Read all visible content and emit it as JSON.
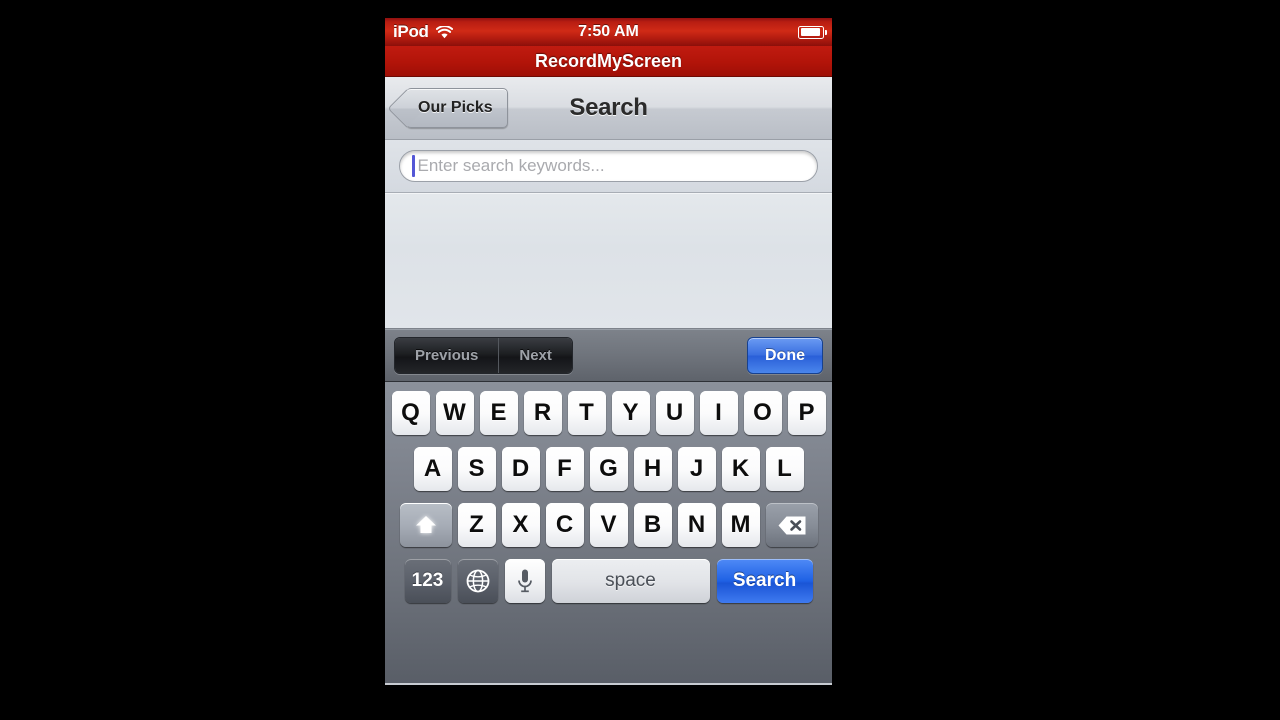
{
  "statusbar": {
    "carrier": "iPod",
    "wifi_icon": "wifi-icon",
    "time": "7:50 AM",
    "battery_icon": "battery-icon"
  },
  "app_banner": {
    "title": "RecordMyScreen"
  },
  "navbar": {
    "back_label": "Our Picks",
    "title": "Search"
  },
  "search": {
    "value": "",
    "placeholder": "Enter search keywords..."
  },
  "accessory": {
    "previous_label": "Previous",
    "next_label": "Next",
    "done_label": "Done"
  },
  "keyboard": {
    "row1": [
      "Q",
      "W",
      "E",
      "R",
      "T",
      "Y",
      "U",
      "I",
      "O",
      "P"
    ],
    "row2": [
      "A",
      "S",
      "D",
      "F",
      "G",
      "H",
      "J",
      "K",
      "L"
    ],
    "row3": [
      "Z",
      "X",
      "C",
      "V",
      "B",
      "N",
      "M"
    ],
    "shift_icon": "shift-arrow-icon",
    "delete_icon": "delete-backspace-icon",
    "numbers_label": "123",
    "globe_icon": "globe-icon",
    "mic_icon": "microphone-icon",
    "space_label": "space",
    "search_label": "Search"
  },
  "colors": {
    "status_red": "#b81d12",
    "banner_red": "#b21409",
    "accent_blue": "#2a5fd8",
    "keyboard_bg": "#7e838d",
    "caret": "#5457d6"
  }
}
